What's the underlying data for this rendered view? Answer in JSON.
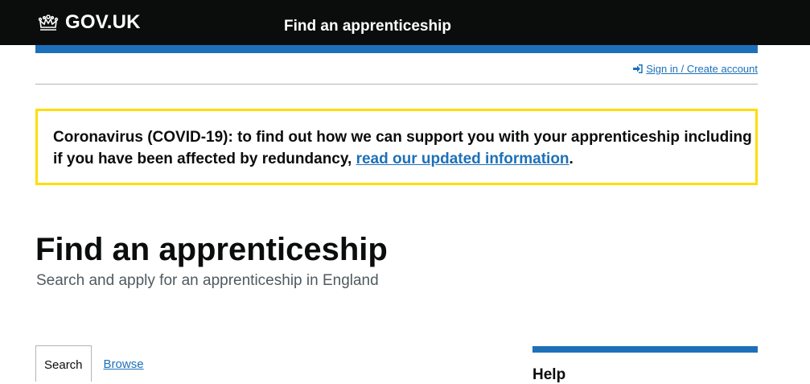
{
  "header": {
    "logo_text": "GOV.UK",
    "service_name": "Find an apprenticeship"
  },
  "account": {
    "signin_label": "Sign in / Create account",
    "signin_icon": "sign-in-icon"
  },
  "notice": {
    "text_before": "Coronavirus (COVID-19): to find out how we can support you with your apprenticeship including if you have been affected by redundancy, ",
    "link_text": "read our updated information",
    "text_after": "."
  },
  "main": {
    "title": "Find an apprenticeship",
    "subtitle": "Search and apply for an apprenticeship in England",
    "tabs": [
      {
        "label": "Search",
        "active": true
      },
      {
        "label": "Browse",
        "active": false
      }
    ]
  },
  "sidebar": {
    "help_title": "Help"
  },
  "colors": {
    "header_bg": "#0b0c0c",
    "brand_blue": "#1d70b8",
    "notice_border": "#ffdd00",
    "secondary_text": "#505a5f"
  }
}
